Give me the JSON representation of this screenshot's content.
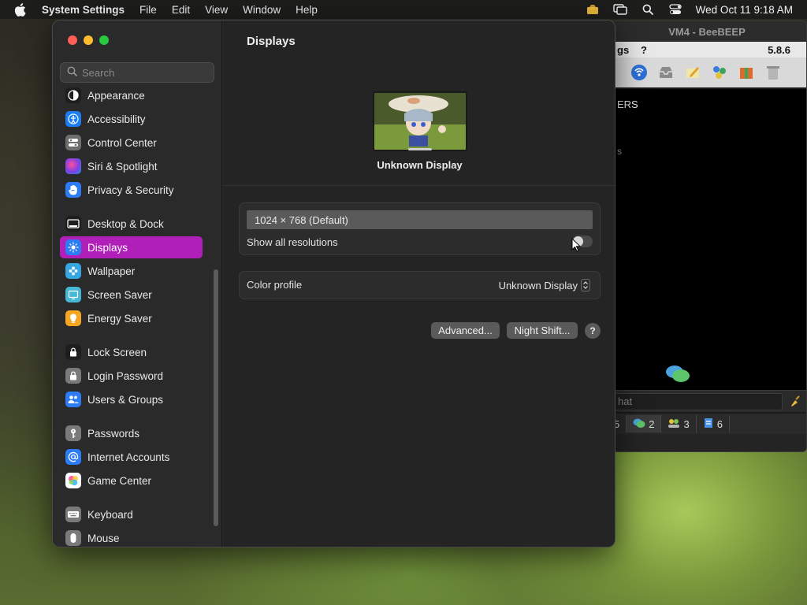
{
  "menubar": {
    "app_name": "System Settings",
    "items": [
      "File",
      "Edit",
      "View",
      "Window",
      "Help"
    ],
    "clock": "Wed Oct 11  9:18 AM"
  },
  "beebeep": {
    "title": "VM4 - BeeBEEP",
    "menu_fragment": "gs",
    "menu_help": "?",
    "version": "5.8.6",
    "chat_line1": "ERS",
    "chat_line2": "s",
    "input_placeholder": "hat",
    "tabs": [
      {
        "icon": "users-icon",
        "count": "5"
      },
      {
        "icon": "chat-icon",
        "count": "2"
      },
      {
        "icon": "group-icon",
        "count": "3"
      },
      {
        "icon": "file-icon",
        "count": "6"
      }
    ]
  },
  "settings": {
    "search_placeholder": "Search",
    "sidebar": [
      {
        "label": "Appearance",
        "icon": "appearance-icon",
        "color": "#1e1e1e"
      },
      {
        "label": "Accessibility",
        "icon": "accessibility-icon",
        "color": "#1a7ef2"
      },
      {
        "label": "Control Center",
        "icon": "control-center-icon",
        "color": "#6e6e6e"
      },
      {
        "label": "Siri & Spotlight",
        "icon": "siri-icon",
        "color": "#7b3fe4"
      },
      {
        "label": "Privacy & Security",
        "icon": "hand-icon",
        "color": "#2d7cf6"
      },
      {
        "label": "Desktop & Dock",
        "icon": "dock-icon",
        "color": "#1e1e1e"
      },
      {
        "label": "Displays",
        "icon": "sun-icon",
        "color": "#2d7cf6",
        "active": true
      },
      {
        "label": "Wallpaper",
        "icon": "wallpaper-icon",
        "color": "#35a6e0"
      },
      {
        "label": "Screen Saver",
        "icon": "screensaver-icon",
        "color": "#45b8d8"
      },
      {
        "label": "Energy Saver",
        "icon": "battery-icon",
        "color": "#f5a623"
      },
      {
        "label": "Lock Screen",
        "icon": "lock-icon",
        "color": "#1e1e1e"
      },
      {
        "label": "Login Password",
        "icon": "lock-icon",
        "color": "#7a7a7a"
      },
      {
        "label": "Users & Groups",
        "icon": "users-icon",
        "color": "#2d7cf6"
      },
      {
        "label": "Passwords",
        "icon": "key-icon",
        "color": "#7a7a7a"
      },
      {
        "label": "Internet Accounts",
        "icon": "at-icon",
        "color": "#2d7cf6"
      },
      {
        "label": "Game Center",
        "icon": "game-center-icon",
        "color": "#ffffff"
      },
      {
        "label": "Keyboard",
        "icon": "keyboard-icon",
        "color": "#7a7a7a"
      },
      {
        "label": "Mouse",
        "icon": "mouse-icon",
        "color": "#7a7a7a"
      }
    ],
    "main": {
      "title": "Displays",
      "display_name": "Unknown Display",
      "resolution_selected": "1024 × 768 (Default)",
      "show_all_label": "Show all resolutions",
      "show_all_on": false,
      "color_profile_label": "Color profile",
      "color_profile_value": "Unknown Display",
      "advanced_button": "Advanced...",
      "night_shift_button": "Night Shift...",
      "help_button": "?"
    }
  }
}
